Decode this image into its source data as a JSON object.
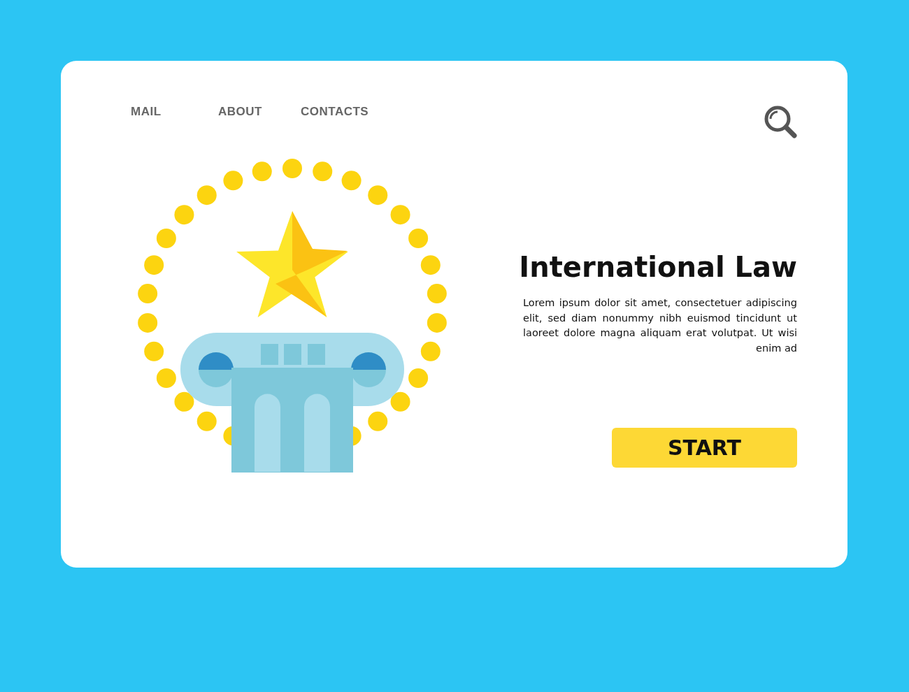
{
  "nav": [
    {
      "label": "MAIL"
    },
    {
      "label": "ABOUT"
    },
    {
      "label": "CONTACTS"
    }
  ],
  "hero": {
    "title": "International Law",
    "text": "Lorem ipsum dolor sit amet, consectetuer adipiscing elit, sed diam nonummy nibh euismod tincidunt ut laoreet dolore magna aliquam erat volutpat. Ut wisi enim ad",
    "button": "START"
  }
}
